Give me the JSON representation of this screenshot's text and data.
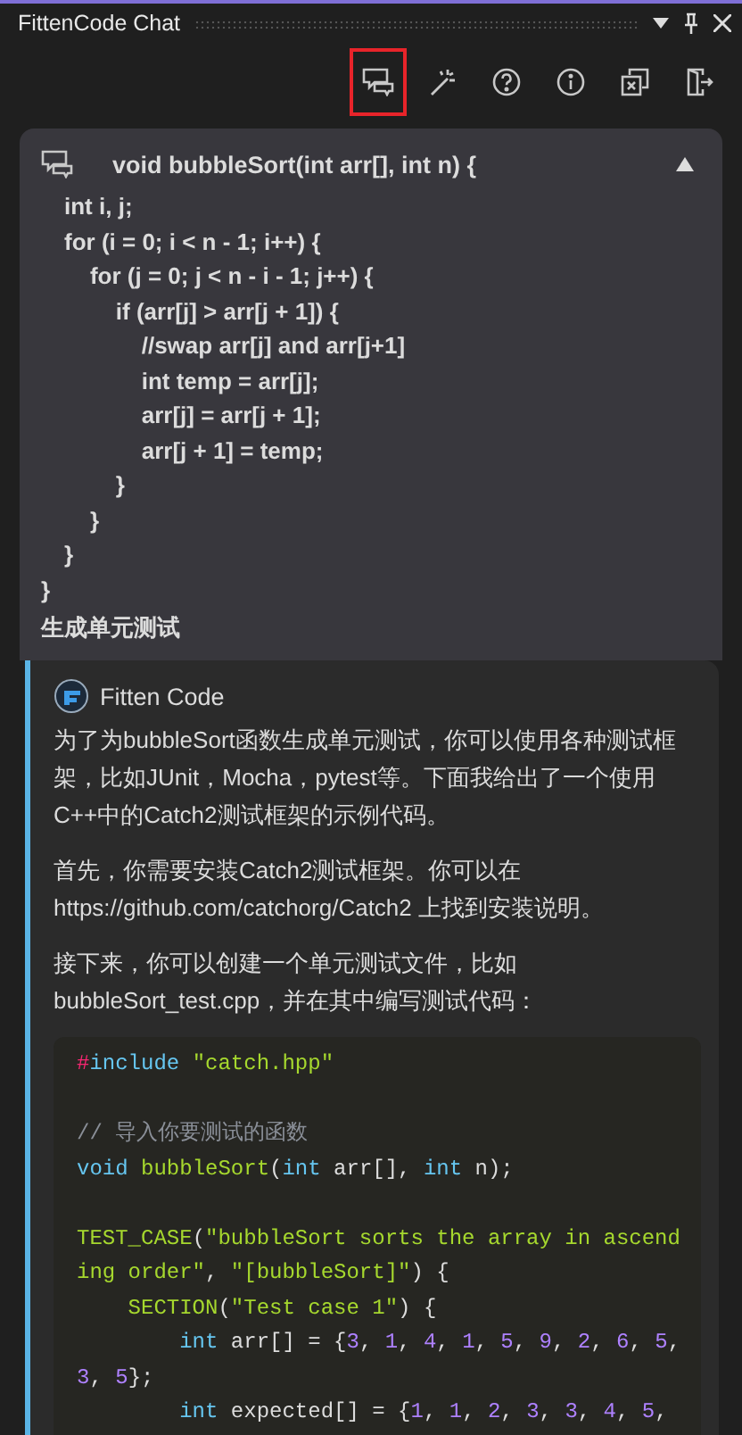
{
  "window": {
    "title": "FittenCode Chat"
  },
  "toolbar": [
    {
      "kind": "chat",
      "selected": true
    },
    {
      "kind": "wand",
      "selected": false
    },
    {
      "kind": "help",
      "selected": false
    },
    {
      "kind": "info",
      "selected": false
    },
    {
      "kind": "close-all",
      "selected": false
    },
    {
      "kind": "exit",
      "selected": false
    }
  ],
  "user_message": {
    "title": "void bubbleSort(int arr[], int n) {",
    "expanded": true,
    "code_lines": [
      "int i, j;",
      "for (i = 0; i < n - 1; i++) {",
      "    for (j = 0; j < n - i - 1; j++) {",
      "        if (arr[j] > arr[j + 1]) {",
      "            //swap arr[j] and arr[j+1]",
      "            int temp = arr[j];",
      "            arr[j] = arr[j + 1];",
      "            arr[j + 1] = temp;",
      "        }",
      "    }",
      "}"
    ],
    "closing": "}",
    "request": "生成单元测试"
  },
  "response": {
    "author": "Fitten Code",
    "paragraphs": [
      {
        "lines": [
          "为了为bubbleSort函数生成单元测试，你可以使用各种测试框",
          "架，比如JUnit，Mocha，pytest等。下面我给出了一个使用",
          "C++中的Catch2测试框架的示例代码。"
        ]
      },
      {
        "lines": [
          "首先，你需要安装Catch2测试框架。你可以在",
          "https://github.com/catchorg/Catch2 上找到安装说明。"
        ]
      },
      {
        "lines": [
          "接下来，你可以创建一个单元测试文件，比如",
          "bubbleSort_test.cpp，并在其中编写测试代码："
        ]
      }
    ],
    "code": [
      {
        "kind": "code",
        "tokens": [
          {
            "kind": "pre",
            "text": "#"
          },
          {
            "kind": "keyword",
            "text": "include"
          },
          {
            "kind": "string",
            "text": " \"catch.hpp\""
          }
        ]
      },
      {
        "kind": "blank"
      },
      {
        "kind": "code",
        "tokens": [
          {
            "kind": "comment",
            "text": "// 导入你要测试的函数"
          }
        ]
      },
      {
        "kind": "code",
        "tokens": [
          {
            "kind": "keyword",
            "text": "void"
          },
          {
            "kind": "function",
            "text": " bubbleSort"
          },
          {
            "kind": "plain",
            "text": "("
          },
          {
            "kind": "keyword",
            "text": "int"
          },
          {
            "kind": "plain",
            "text": " arr[], "
          },
          {
            "kind": "keyword",
            "text": "int"
          },
          {
            "kind": "plain",
            "text": " n);"
          }
        ]
      },
      {
        "kind": "blank"
      },
      {
        "kind": "code",
        "tokens": [
          {
            "kind": "function",
            "text": "TEST_CASE"
          },
          {
            "kind": "plain",
            "text": "("
          },
          {
            "kind": "string",
            "text": "\"bubbleSort sorts the array in ascend"
          }
        ]
      },
      {
        "kind": "code",
        "tokens": [
          {
            "kind": "string",
            "text": "ing order\""
          },
          {
            "kind": "plain",
            "text": ", "
          },
          {
            "kind": "string",
            "text": "\"[bubbleSort]\""
          },
          {
            "kind": "plain",
            "text": ") {"
          }
        ]
      },
      {
        "kind": "code",
        "tokens": [
          {
            "kind": "function",
            "text": "    SECTION"
          },
          {
            "kind": "plain",
            "text": "("
          },
          {
            "kind": "string",
            "text": "\"Test case 1\""
          },
          {
            "kind": "plain",
            "text": ") {"
          }
        ]
      },
      {
        "kind": "code",
        "tokens": [
          {
            "kind": "keyword",
            "text": "        int"
          },
          {
            "kind": "plain",
            "text": " arr[] = {"
          },
          {
            "kind": "number",
            "text": "3"
          },
          {
            "kind": "plain",
            "text": ", "
          },
          {
            "kind": "number",
            "text": "1"
          },
          {
            "kind": "plain",
            "text": ", "
          },
          {
            "kind": "number",
            "text": "4"
          },
          {
            "kind": "plain",
            "text": ", "
          },
          {
            "kind": "number",
            "text": "1"
          },
          {
            "kind": "plain",
            "text": ", "
          },
          {
            "kind": "number",
            "text": "5"
          },
          {
            "kind": "plain",
            "text": ", "
          },
          {
            "kind": "number",
            "text": "9"
          },
          {
            "kind": "plain",
            "text": ", "
          },
          {
            "kind": "number",
            "text": "2"
          },
          {
            "kind": "plain",
            "text": ", "
          },
          {
            "kind": "number",
            "text": "6"
          },
          {
            "kind": "plain",
            "text": ", "
          },
          {
            "kind": "number",
            "text": "5"
          },
          {
            "kind": "plain",
            "text": ","
          }
        ]
      },
      {
        "kind": "code",
        "tokens": [
          {
            "kind": "number",
            "text": "3"
          },
          {
            "kind": "plain",
            "text": ", "
          },
          {
            "kind": "number",
            "text": "5"
          },
          {
            "kind": "plain",
            "text": "};"
          }
        ]
      },
      {
        "kind": "code",
        "tokens": [
          {
            "kind": "keyword",
            "text": "        int"
          },
          {
            "kind": "plain",
            "text": " expected[] = {"
          },
          {
            "kind": "number",
            "text": "1"
          },
          {
            "kind": "plain",
            "text": ", "
          },
          {
            "kind": "number",
            "text": "1"
          },
          {
            "kind": "plain",
            "text": ", "
          },
          {
            "kind": "number",
            "text": "2"
          },
          {
            "kind": "plain",
            "text": ", "
          },
          {
            "kind": "number",
            "text": "3"
          },
          {
            "kind": "plain",
            "text": ", "
          },
          {
            "kind": "number",
            "text": "3"
          },
          {
            "kind": "plain",
            "text": ", "
          },
          {
            "kind": "number",
            "text": "4"
          },
          {
            "kind": "plain",
            "text": ", "
          },
          {
            "kind": "number",
            "text": "5"
          },
          {
            "kind": "plain",
            "text": ","
          }
        ]
      }
    ]
  }
}
